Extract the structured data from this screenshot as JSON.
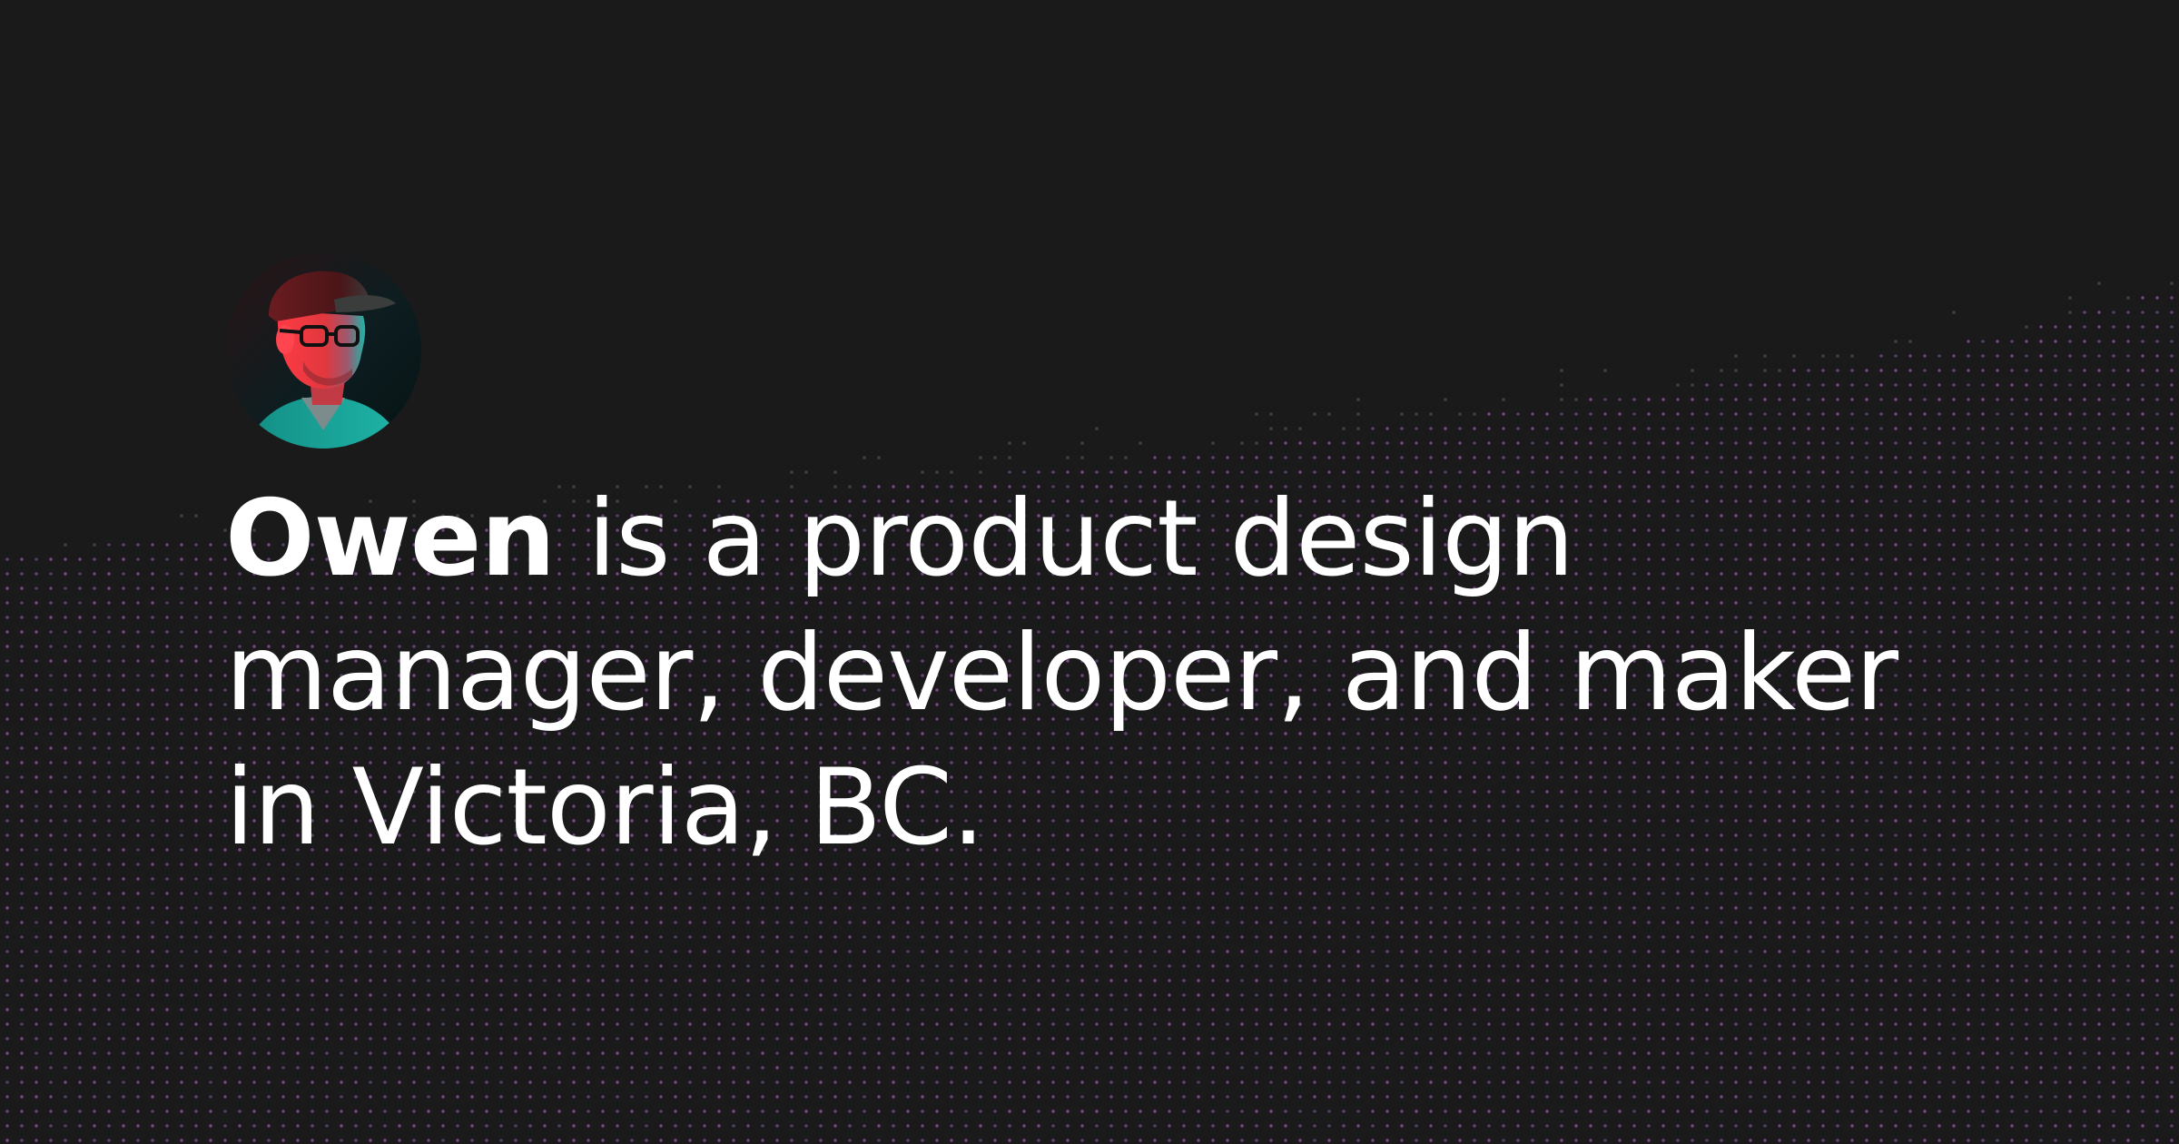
{
  "hero": {
    "avatar_alt": "Portrait of Owen",
    "name": "Owen",
    "line_1_rest": " is a product design",
    "line_2": "manager, developer, and maker",
    "line_3": "in Victoria, BC."
  },
  "colors": {
    "background": "#1a1a1b",
    "text": "#ffffff",
    "dot_pattern": "#8a5a9a",
    "avatar_red": "#e0383e",
    "avatar_teal": "#1fb5a8"
  },
  "icons": {
    "avatar": "person-portrait-icon"
  }
}
